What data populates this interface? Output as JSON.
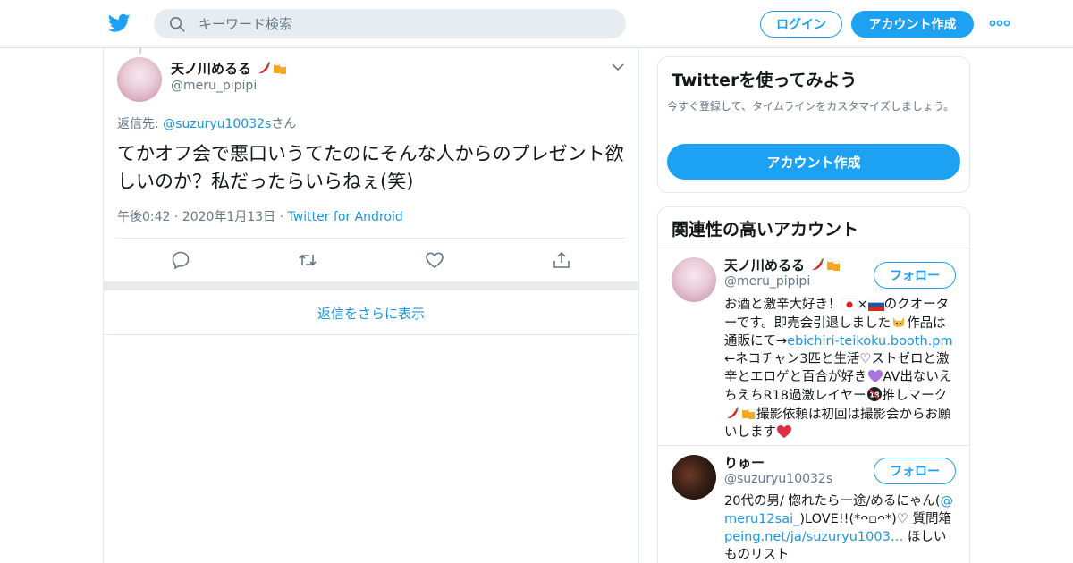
{
  "header": {
    "search_placeholder": "キーワード検索",
    "login_label": "ログイン",
    "signup_label": "アカウント作成"
  },
  "tweet": {
    "author_name": "天ノ川めるる",
    "author_handle": "@meru_pipipi",
    "replying_prefix": "返信先: ",
    "replying_handle": "@suzuryu10032s",
    "replying_suffix": "さん",
    "text": "てかオフ会で悪口いうてたのにそんな人からのプレゼント欲しいのか？私だったらいらねぇ(笑)",
    "time": "午後0:42",
    "date": "2020年1月13日",
    "source": "Twitter for Android",
    "sep": " · "
  },
  "show_more_label": "返信をさらに表示",
  "signup_card": {
    "title": "Twitterを使ってみよう",
    "subtitle": "今すぐ登録して、タイムラインをカスタマイズしましょう。",
    "button": "アカウント作成"
  },
  "related": {
    "title": "関連性の高いアカウント",
    "follow_label": "フォロー",
    "accounts": [
      {
        "name": "天ノ川めるる",
        "handle": "@meru_pipipi",
        "bio_1": "お酒と激辛大好き！",
        "bio_2": "のクオーターです。即売会引退しました",
        "bio_3": "作品は通販にて→",
        "bio_link": "ebichiri-teikoku.booth.pm",
        "bio_4": "←ネコチャン3匹と生活♡ストゼロと激辛とエロゲと百合が好き",
        "bio_5": "AV出ないえちえちR18過激レイヤー",
        "bio_6": "推しマーク",
        "bio_7": "撮影依頼は初回は撮影会からお願いします"
      },
      {
        "name": "りゅー",
        "handle": "@suzuryu10032s",
        "bio_1": "20代の男/ 惚れたら一途/めるにゃん(",
        "bio_link1": "@meru12sai_",
        "bio_2": ")LOVE!!(*ᴖ▫︎ᴖ*)♡ 質問箱 ",
        "bio_link2": "peing.net/ja/suzuryu1003…",
        "bio_3": " ほしいものリスト"
      }
    ]
  },
  "colors": {
    "accent": "#1da1f2",
    "link": "#1b95e0",
    "secondary_text": "#657786",
    "border": "#e1e8ed"
  }
}
